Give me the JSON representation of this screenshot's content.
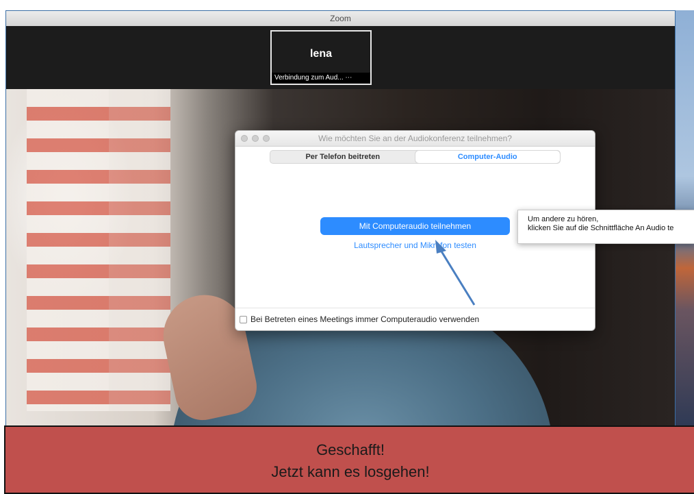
{
  "window": {
    "title": "Zoom"
  },
  "participant": {
    "name": "lena",
    "status": "Verbindung zum Aud... ⋯"
  },
  "dialog": {
    "title": "Wie möchten Sie an der Audiokonferenz teilnehmen?",
    "tabs": [
      {
        "label": "Per Telefon beitreten",
        "active": false
      },
      {
        "label": "Computer-Audio",
        "active": true
      }
    ],
    "primary_button": "Mit Computeraudio teilnehmen",
    "test_link": "Lautsprecher und Mikrofon testen",
    "footer_checkbox_label": "Bei Betreten eines Meetings immer Computeraudio verwenden",
    "footer_checkbox_checked": false
  },
  "tooltip": {
    "line1": "Um andere zu hören,",
    "line2": "klicken Sie auf die Schnittfläche An Audio te"
  },
  "banner": {
    "line1": "Geschafft!",
    "line2": "Jetzt kann es losgehen!"
  },
  "colors": {
    "accent": "#2d8cff",
    "banner": "#c0504d",
    "annotation_arrow": "#4a7fc1"
  }
}
